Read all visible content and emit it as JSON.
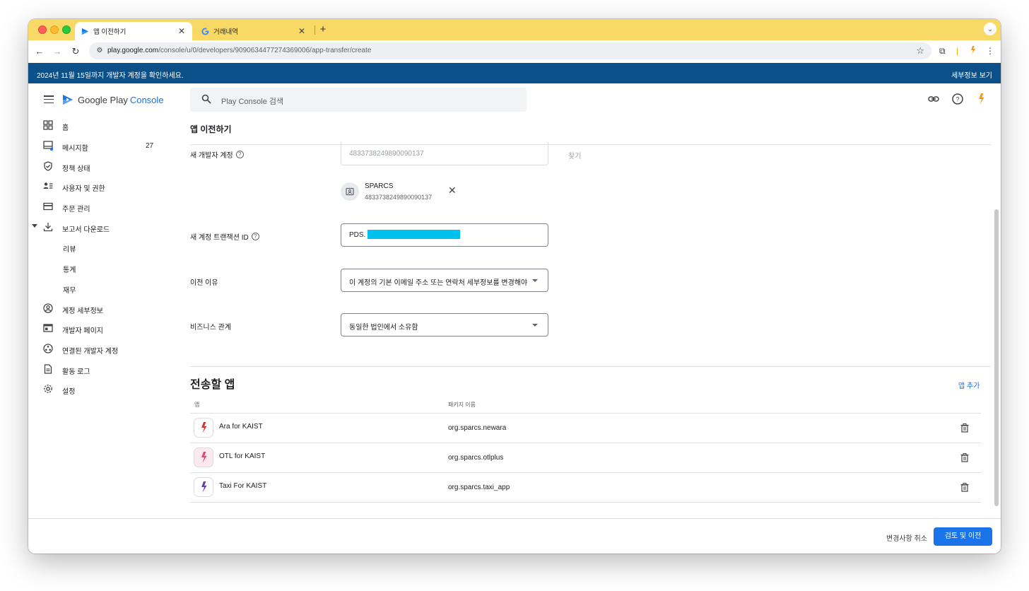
{
  "browser": {
    "tabs": [
      {
        "title": "앱 이전하기",
        "active": true,
        "favicon": "play-console-icon"
      },
      {
        "title": "거래내역",
        "active": false,
        "favicon": "google-g-icon"
      }
    ],
    "new_tab": "+",
    "url_host": "play.google.com",
    "url_path": "/console/u/0/developers/9090634477274369006/app-transfer/create"
  },
  "banner": {
    "message": "2024년 11월 15일까지 개발자 계정을 확인하세요.",
    "link": "세부정보 보기"
  },
  "header": {
    "logo_google": "Google Play",
    "logo_console": "Console",
    "search_placeholder": "Play Console 검색"
  },
  "sidebar": {
    "items": [
      {
        "label": "홈",
        "icon": "grid-icon"
      },
      {
        "label": "메시지함",
        "icon": "inbox-icon",
        "count": "27"
      },
      {
        "label": "정책 상태",
        "icon": "shield-check-icon"
      },
      {
        "label": "사용자 및 권한",
        "icon": "users-icon"
      },
      {
        "label": "주문 관리",
        "icon": "credit-card-icon"
      },
      {
        "label": "보고서 다운로드",
        "icon": "download-icon",
        "expanded": true
      },
      {
        "label": "계정 세부정보",
        "icon": "account-icon"
      },
      {
        "label": "개발자 페이지",
        "icon": "web-page-icon"
      },
      {
        "label": "연결된 개발자 계정",
        "icon": "linked-accounts-icon"
      },
      {
        "label": "활동 로그",
        "icon": "document-icon"
      },
      {
        "label": "설정",
        "icon": "gear-icon"
      }
    ],
    "sub_items": [
      "리뷰",
      "통계",
      "재무"
    ]
  },
  "page": {
    "title": "앱 이전하기",
    "new_dev_label": "새 개발자 계정",
    "new_dev_value": "4833738249890090137",
    "find_link": "찾기",
    "chip_name": "SPARCS",
    "chip_id": "4833738249890090137",
    "txn_label": "새 계정 트랜잭션 ID",
    "txn_value": "PDS.",
    "reason_label": "이전 이유",
    "reason_value": "이 계정의 기본 이메일 주소 또는 연락처 세부정보를 변경해야 ...",
    "biz_label": "비즈니스 관계",
    "biz_value": "동일한 법인에서 소유함",
    "apps_section": "전송할 앱",
    "add_app": "앱 추가",
    "col_app": "앱",
    "col_pkg": "패키지 이름",
    "apps": [
      {
        "name": "Ara for KAIST",
        "package": "org.sparcs.newara",
        "icon_color": "#d93434"
      },
      {
        "name": "OTL for KAIST",
        "package": "org.sparcs.otlplus",
        "icon_color": "#e0457b"
      },
      {
        "name": "Taxi For KAIST",
        "package": "org.sparcs.taxi_app",
        "icon_color": "#6b3fa0"
      }
    ]
  },
  "footer": {
    "cancel": "변경사항 취소",
    "submit": "검토 및 이전"
  },
  "colors": {
    "tabstrip": "#f8d965",
    "banner": "#0b5088",
    "primary": "#1a73e8",
    "redaction": "#00c0f0"
  }
}
